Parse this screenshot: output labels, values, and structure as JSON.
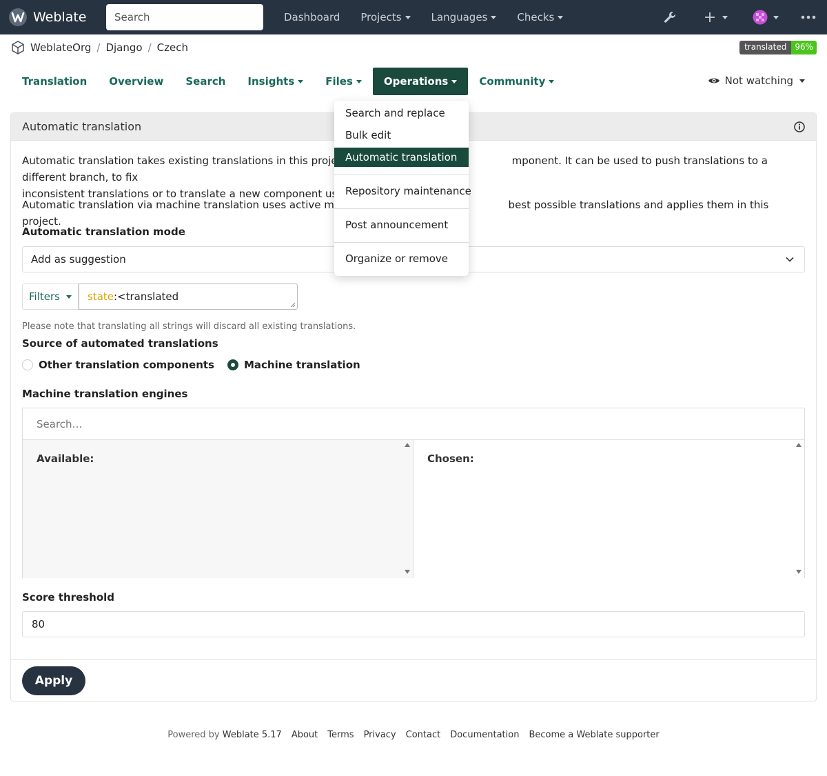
{
  "navbar": {
    "brand": "Weblate",
    "search_placeholder": "Search",
    "links": [
      "Dashboard",
      "Projects",
      "Languages",
      "Checks"
    ]
  },
  "breadcrumb": [
    "WeblateOrg",
    "Django",
    "Czech"
  ],
  "badge": {
    "label": "translated",
    "value": "96%"
  },
  "tabs": [
    "Translation",
    "Overview",
    "Search",
    "Insights",
    "Files",
    "Operations",
    "Community"
  ],
  "watch": {
    "label": "Not watching"
  },
  "panel": {
    "title": "Automatic translation",
    "para1_a": "Automatic translation takes existing translations in this project and a",
    "para1_b": "mponent. It can be used to push translations to a different branch, to fix",
    "para1_c": "inconsistent translations or to translate a new component using tran",
    "para2_a": "Automatic translation via machine translation uses active machine tr",
    "para2_b": "best possible translations and applies them in this project.",
    "mode_label": "Automatic translation mode",
    "mode_value": "Add as suggestion",
    "filters_label": "Filters",
    "filter_keyword": "state",
    "filter_rest": ":<translated",
    "note": "Please note that translating all strings will discard all existing translations.",
    "source_label": "Source of automated translations",
    "radio_options": [
      "Other translation components",
      "Machine translation"
    ],
    "engines_label": "Machine translation engines",
    "engines_search": "Search…",
    "available": "Available:",
    "chosen": "Chosen:",
    "score_label": "Score threshold",
    "score_value": "80",
    "apply": "Apply"
  },
  "dropdown": {
    "items": [
      "Search and replace",
      "Bulk edit",
      "Automatic translation",
      "Repository maintenance",
      "Post announcement",
      "Organize or remove"
    ]
  },
  "footer": {
    "powered_by": "Powered by",
    "version": "Weblate 5.17",
    "links": [
      "About",
      "Terms",
      "Privacy",
      "Contact",
      "Documentation",
      "Become a Weblate supporter"
    ]
  },
  "colors": {
    "navbar_bg": "#283341",
    "accent": "#1a4a3b",
    "link_green": "#19695a",
    "badge_green": "#4bc51d"
  }
}
